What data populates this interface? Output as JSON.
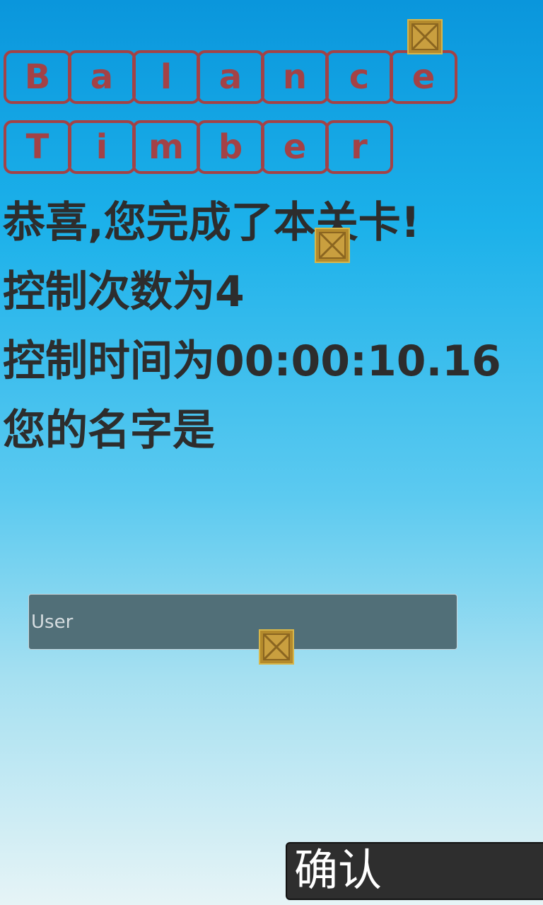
{
  "title": {
    "row1": [
      "B",
      "a",
      "l",
      "a",
      "n",
      "c",
      "e"
    ],
    "row2": [
      "T",
      "i",
      "m",
      "b",
      "e",
      "r"
    ]
  },
  "result": {
    "congrats": "恭喜,您完成了本关卡!",
    "control_count": "控制次数为4",
    "control_time": "控制时间为00:00:10.16",
    "name_prompt": "您的名字是"
  },
  "name_input": {
    "value": "User"
  },
  "confirm_button": {
    "label": "确认"
  },
  "icons": {
    "crate": "wooden-crate-icon"
  },
  "colors": {
    "tile_border": "#a34246",
    "text": "#2d2d2d",
    "input_bg": "#516f78",
    "button_bg": "#2e2e2e"
  }
}
